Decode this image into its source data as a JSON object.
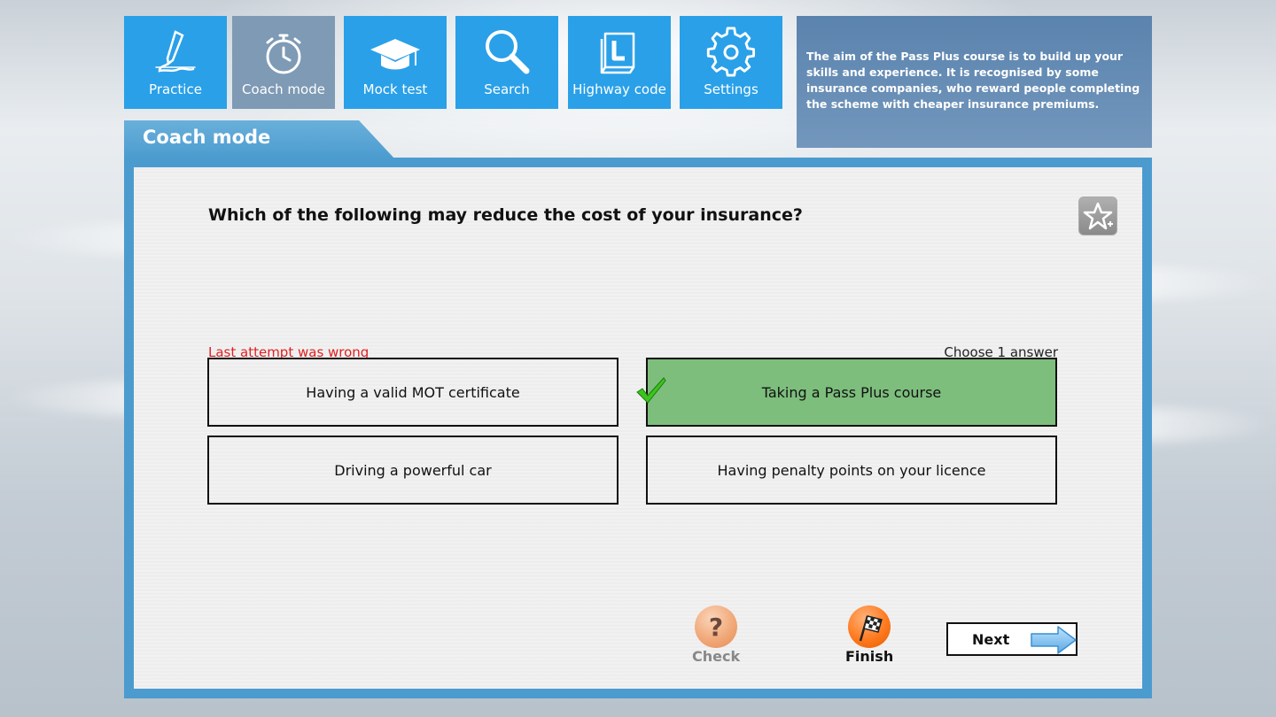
{
  "nav": {
    "tiles": [
      {
        "label": "Practice",
        "icon": "pen-signature-icon",
        "active": false
      },
      {
        "label": "Coach mode",
        "icon": "stopwatch-icon",
        "active": true
      },
      {
        "label": "Mock test",
        "icon": "graduation-cap-icon",
        "active": false
      },
      {
        "label": "Search",
        "icon": "magnifier-icon",
        "active": false
      },
      {
        "label": "Highway code",
        "icon": "l-plate-book-icon",
        "active": false
      },
      {
        "label": "Settings",
        "icon": "gear-icon",
        "active": false
      }
    ]
  },
  "info": {
    "text": "The aim of the Pass Plus course is to build up your skills and experience. It is recognised by some insurance companies, who reward people completing the scheme with cheaper insurance premiums."
  },
  "panel": {
    "title": "Coach mode"
  },
  "question": {
    "text": "Which of the following may reduce the cost of your insurance?",
    "status": "Last attempt was wrong",
    "instruction": "Choose 1 answer",
    "answers": [
      {
        "text": "Having a valid MOT certificate",
        "correct": false
      },
      {
        "text": "Taking a Pass Plus course",
        "correct": true
      },
      {
        "text": "Driving a powerful car",
        "correct": false
      },
      {
        "text": "Having penalty points on your licence",
        "correct": false
      }
    ]
  },
  "controls": {
    "check_label": "Check",
    "finish_label": "Finish",
    "next_label": "Next"
  },
  "colors": {
    "tile_blue": "#2aa0e8",
    "tile_active": "#7e9ab5",
    "panel_blue": "#4b9bcf",
    "correct_green": "#7dbe7d",
    "wrong_red": "#e02020"
  }
}
